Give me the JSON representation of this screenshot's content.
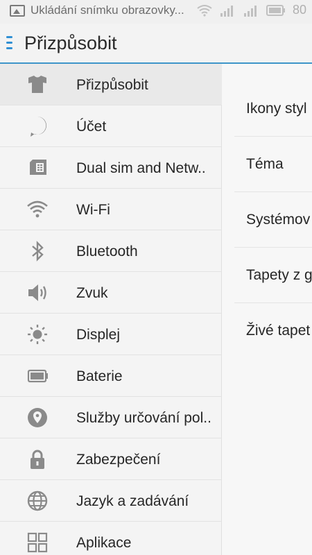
{
  "status_bar": {
    "notification_text": "Ukládání snímku obrazovky...",
    "battery": "80"
  },
  "toolbar": {
    "title": "Přizpůsobit"
  },
  "sidebar": {
    "items": [
      {
        "label": "Přizpůsobit",
        "icon": "shirt-icon",
        "selected": true
      },
      {
        "label": "Účet",
        "icon": "account-cloud-icon"
      },
      {
        "label": "Dual sim and Netw..",
        "icon": "sim-card-icon"
      },
      {
        "label": "Wi-Fi",
        "icon": "wifi-icon"
      },
      {
        "label": "Bluetooth",
        "icon": "bluetooth-icon"
      },
      {
        "label": "Zvuk",
        "icon": "speaker-icon"
      },
      {
        "label": "Displej",
        "icon": "brightness-icon"
      },
      {
        "label": "Baterie",
        "icon": "battery-icon"
      },
      {
        "label": "Služby určování pol..",
        "icon": "location-pin-icon"
      },
      {
        "label": "Zabezpečení",
        "icon": "lock-icon"
      },
      {
        "label": "Jazyk a zadávání",
        "icon": "globe-icon"
      },
      {
        "label": "Aplikace",
        "icon": "apps-grid-icon"
      }
    ]
  },
  "detail": {
    "items": [
      {
        "label": "Ikony styl"
      },
      {
        "label": "Téma"
      },
      {
        "label": "Systémov"
      },
      {
        "label": "Tapety z g"
      },
      {
        "label": "Živé tapet"
      }
    ]
  },
  "colors": {
    "accent": "#3d95c9",
    "icon_gray": "#8a8a8a",
    "text": "#262626"
  }
}
